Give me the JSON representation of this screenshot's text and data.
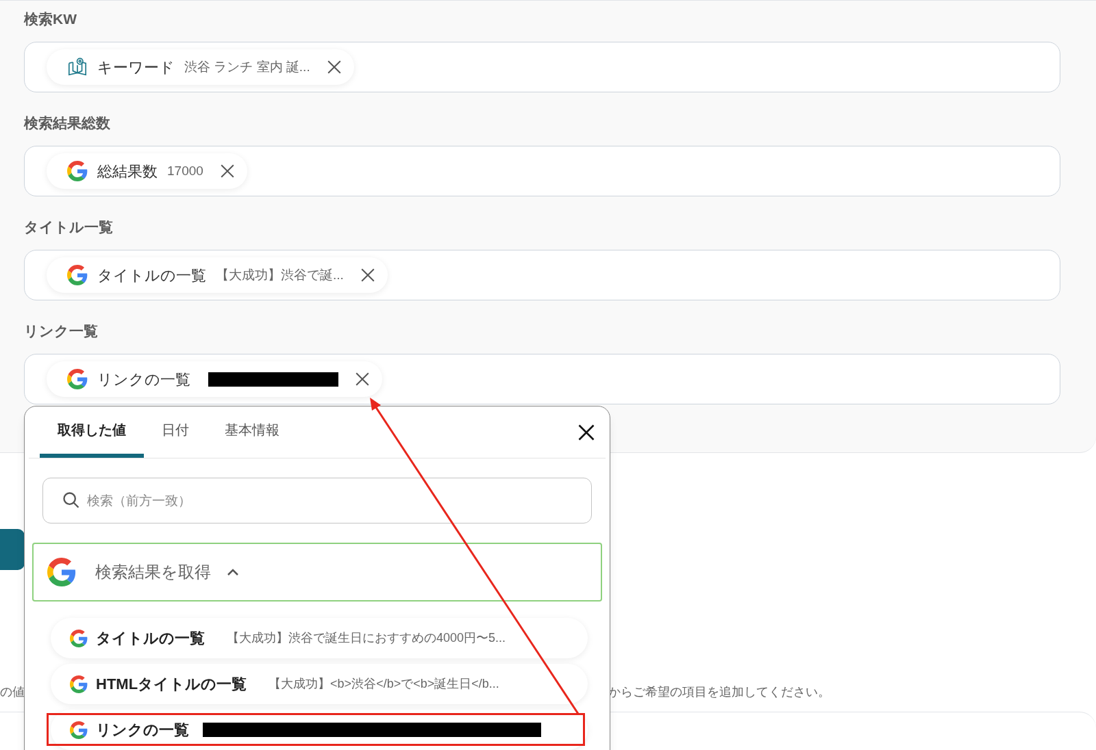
{
  "fields": [
    {
      "label": "検索KW",
      "chip": {
        "kind": "book",
        "name": "キーワード",
        "value": "渋谷 ランチ 室内 誕..."
      }
    },
    {
      "label": "検索結果総数",
      "chip": {
        "kind": "google",
        "name": "総結果数",
        "value": "17000"
      }
    },
    {
      "label": "タイトル一覧",
      "chip": {
        "kind": "google",
        "name": "タイトルの一覧",
        "value": "【大成功】渋谷で誕..."
      }
    },
    {
      "label": "リンク一覧",
      "chip": {
        "kind": "google",
        "name": "リンクの一覧",
        "redacted": true
      }
    }
  ],
  "background": {
    "left_text": "の値",
    "hint": "からご希望の項目を追加してください。"
  },
  "popup": {
    "tabs": [
      {
        "label": "取得した値",
        "selected": true
      },
      {
        "label": "日付",
        "selected": false
      },
      {
        "label": "基本情報",
        "selected": false
      }
    ],
    "search": {
      "placeholder": "検索（前方一致）"
    },
    "group": {
      "title": "検索結果を取得",
      "expanded": true
    },
    "items": [
      {
        "name": "タイトルの一覧",
        "value": "【大成功】渋谷で誕生日におすすめの4000円〜5...",
        "highlighted": false
      },
      {
        "name": "HTMLタイトルの一覧",
        "value": "【大成功】<b>渋谷</b>で<b>誕生日</b...",
        "highlighted": false
      },
      {
        "name": "リンクの一覧",
        "redacted": true,
        "highlighted": true
      }
    ]
  }
}
